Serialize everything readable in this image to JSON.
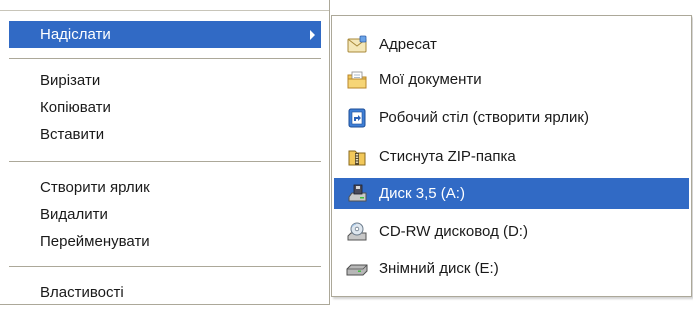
{
  "context_menu": {
    "items": [
      {
        "label": "Надіслати",
        "highlighted": true,
        "has_submenu": true
      },
      {
        "label": "Вирізати"
      },
      {
        "label": "Копіювати"
      },
      {
        "label": "Вставити"
      },
      {
        "label": "Створити ярлик"
      },
      {
        "label": "Видалити"
      },
      {
        "label": "Перейменувати"
      },
      {
        "label": "Властивості"
      }
    ]
  },
  "send_to_submenu": {
    "items": [
      {
        "label": "Адресат",
        "icon": "envelope-icon"
      },
      {
        "label": "Мої документи",
        "icon": "my-documents-folder-icon"
      },
      {
        "label": "Робочий стіл (створити ярлик)",
        "icon": "desktop-shortcut-icon"
      },
      {
        "label": "Стиснута  ZIP-папка",
        "icon": "zip-folder-icon"
      },
      {
        "label": "Диск 3,5 (A:)",
        "icon": "floppy-drive-icon",
        "highlighted": true
      },
      {
        "label": "CD-RW дисковод (D:)",
        "icon": "cd-drive-icon"
      },
      {
        "label": "Знімний диск (E:)",
        "icon": "removable-disk-icon"
      }
    ]
  },
  "colors": {
    "highlight": "#316ac5",
    "highlight_text": "#ffffff",
    "separator": "#aca899"
  }
}
